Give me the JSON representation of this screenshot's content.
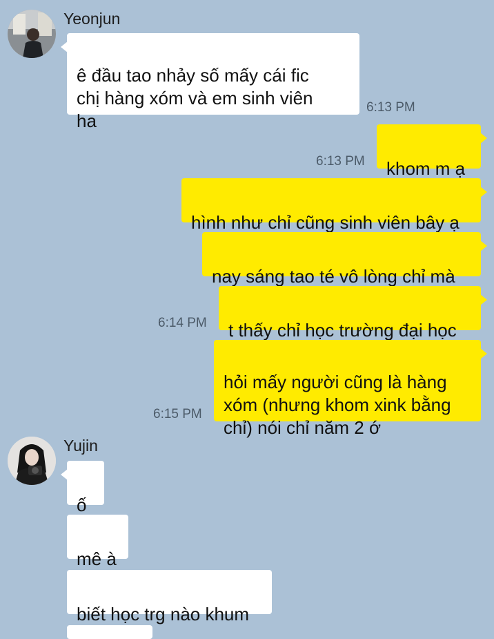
{
  "contacts": [
    {
      "name": "Yeonjun",
      "avatar_icon": "person-photo-icon"
    },
    {
      "name": "Yujin",
      "avatar_icon": "person-photo-icon"
    }
  ],
  "messages": [
    {
      "text": "ê đầu tao nhảy số mấy cái fic\nchị hàng xóm và em sinh viên\nha",
      "time": "6:13 PM"
    },
    {
      "text": "khom m ạ",
      "time": "6:13 PM"
    },
    {
      "text": "hình như chỉ cũng sinh viên bây ạ"
    },
    {
      "text": "nay sáng tao té vô lòng chỉ mà"
    },
    {
      "text": "t thấy chỉ học trường đại học",
      "time": "6:14 PM"
    },
    {
      "text": "hỏi mấy người cũng là hàng\nxóm (nhưng khom xink bằng\nchỉ) nói chỉ năm 2 ớ",
      "time": "6:15 PM"
    },
    {
      "text": "ố"
    },
    {
      "text": "mê à"
    },
    {
      "text": "biết học trg nào khum"
    }
  ],
  "colors": {
    "background": "#abc1d6",
    "incoming_bubble": "#ffffff",
    "outgoing_bubble": "#ffeb00"
  }
}
